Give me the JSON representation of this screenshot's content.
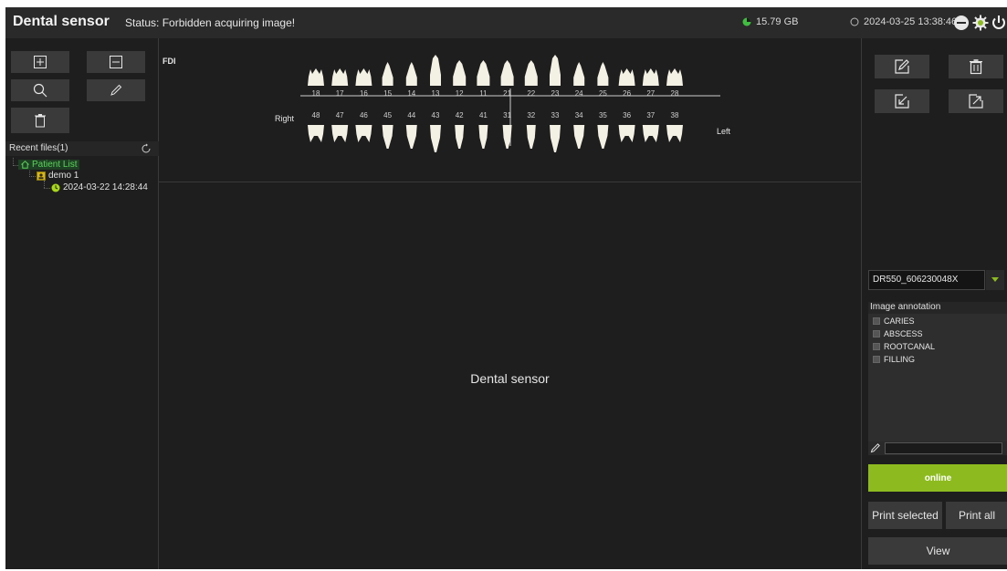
{
  "header": {
    "app_title": "Dental sensor",
    "status": "Status: Forbidden acquiring image!",
    "disk_free": "15.79 GB",
    "datetime": "2024-03-25 13:38:46",
    "icons": [
      "disk-icon",
      "clock-icon",
      "minimize-icon",
      "settings-gear-icon",
      "power-icon"
    ]
  },
  "left_panel": {
    "tools": [
      "add-icon",
      "remove-icon",
      "search-icon",
      "pencil-icon",
      "trash-icon"
    ],
    "recent_files_label": "Recent files(1)",
    "tree": {
      "root": "Patient List",
      "patient": "demo 1",
      "exam": "2024-03-22 14:28:44"
    }
  },
  "tooth_chart": {
    "system_label": "FDI",
    "right_label": "Right",
    "left_label": "Left",
    "upper_teeth": [
      "18",
      "17",
      "16",
      "15",
      "14",
      "13",
      "12",
      "11",
      "21",
      "22",
      "23",
      "24",
      "25",
      "26",
      "27",
      "28"
    ],
    "lower_teeth": [
      "48",
      "47",
      "46",
      "45",
      "44",
      "43",
      "42",
      "41",
      "31",
      "32",
      "33",
      "34",
      "35",
      "36",
      "37",
      "38"
    ]
  },
  "canvas": {
    "placeholder": "Dental sensor"
  },
  "right_panel": {
    "image_tools": [
      "note-edit-icon",
      "trash-icon",
      "import-icon",
      "export-icon"
    ],
    "device": "DR550_606230048X",
    "annotation_label": "Image annotation",
    "annotations": [
      "CARIES",
      "ABSCESS",
      "ROOTCANAL",
      "FILLING"
    ],
    "annotation_input_value": "",
    "online_label": "online",
    "print_selected_label": "Print selected",
    "print_all_label": "Print all",
    "view_label": "View"
  },
  "colors": {
    "background": "#1e1e1e",
    "topbar": "#2a2a2a",
    "button": "#3a3a3a",
    "accent_green": "#8dbb1f",
    "tree_green": "#5ad35a",
    "tooth": "#f3f0e4"
  }
}
